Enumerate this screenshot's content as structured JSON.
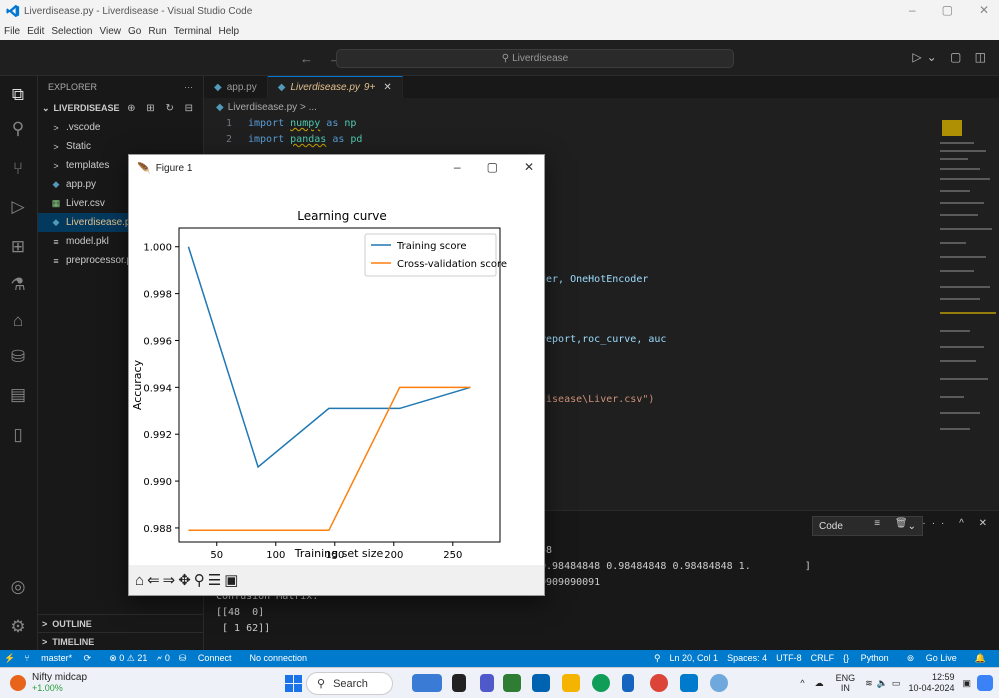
{
  "window": {
    "title": "Liverdisease.py - Liverdisease - Visual Studio Code",
    "controls": [
      "–",
      "▢",
      "✕"
    ]
  },
  "menu": [
    "File",
    "Edit",
    "Selection",
    "View",
    "Go",
    "Run",
    "Terminal",
    "Help"
  ],
  "command_center": {
    "search_text": "Liverdisease"
  },
  "explorer": {
    "header": "EXPLORER",
    "more": "···",
    "project": "LIVERDISEASE",
    "items": [
      {
        "label": ".vscode",
        "icon": ">"
      },
      {
        "label": "Static",
        "icon": ">"
      },
      {
        "label": "templates",
        "icon": ">"
      },
      {
        "label": "app.py",
        "icon": "◆"
      },
      {
        "label": "Liver.csv",
        "icon": "▦"
      },
      {
        "label": "Liverdisease.py",
        "icon": "◆"
      },
      {
        "label": "model.pkl",
        "icon": "≡"
      },
      {
        "label": "preprocessor.pkl",
        "icon": "≡"
      }
    ],
    "outline": "OUTLINE",
    "timeline": "TIMELINE"
  },
  "tabs": [
    {
      "label": "app.py"
    },
    {
      "label": "Liverdisease.py",
      "badge": "9+"
    }
  ],
  "breadcrumb": "Liverdisease.py > ...",
  "code": {
    "line1": {
      "num": "1",
      "kw": "import",
      "mod": "numpy",
      "as": "as",
      "alias": "np"
    },
    "line2": {
      "num": "2",
      "kw": "import",
      "mod": "pandas",
      "as": "as",
      "alias": "pd"
    },
    "frag_encoder": "der, OneHotEncoder",
    "frag_report": "report,roc_curve, auc",
    "frag_csv": "disease\\Liver.csv\")"
  },
  "panel": {
    "dropdown": "Code",
    "line1": "58",
    "line2": "0.98484848 0.98484848 0.98484848 1.         ]",
    "line3": "0909090091",
    "line4": "Confusion Matrix:",
    "line5": "[[48  0]",
    "line6": " [ 1 62]]"
  },
  "statusbar": {
    "branch": "master*",
    "errors": "⊗ 0 ⚠ 21",
    "ports": "🗲 0",
    "connect": "Connect",
    "no_connection": "No connection",
    "position": "Ln 20, Col 1",
    "spaces": "Spaces: 4",
    "encoding": "UTF-8",
    "eol": "CRLF",
    "language": "Python",
    "golive": "Go Live"
  },
  "taskbar": {
    "stock_name": "Nifty midcap",
    "stock_change": "+1.00%",
    "search": "Search",
    "lang": "ENG",
    "region": "IN",
    "time": "12:59",
    "date": "10-04-2024"
  },
  "figure": {
    "window_title": "Figure 1"
  },
  "chart_data": {
    "type": "line",
    "title": "Learning curve",
    "xlabel": "Training set size",
    "ylabel": "Accuracy",
    "xlim": [
      18,
      290
    ],
    "ylim": [
      0.9874,
      1.0008
    ],
    "xticks": [
      50,
      100,
      150,
      200,
      250
    ],
    "yticks": [
      0.988,
      0.99,
      0.992,
      0.994,
      0.996,
      0.998,
      1.0
    ],
    "ytick_labels": [
      "0.988",
      "0.990",
      "0.992",
      "0.994",
      "0.996",
      "0.998",
      "1.000"
    ],
    "legend_position": "top-right",
    "series": [
      {
        "name": "Training score",
        "color": "#1f77b4",
        "x": [
          26,
          85,
          145,
          205,
          265
        ],
        "y": [
          1.0,
          0.9906,
          0.9931,
          0.9931,
          0.994
        ]
      },
      {
        "name": "Cross-validation score",
        "color": "#ff7f0e",
        "x": [
          26,
          85,
          145,
          205,
          265
        ],
        "y": [
          0.9879,
          0.9879,
          0.9879,
          0.994,
          0.994
        ]
      }
    ]
  }
}
